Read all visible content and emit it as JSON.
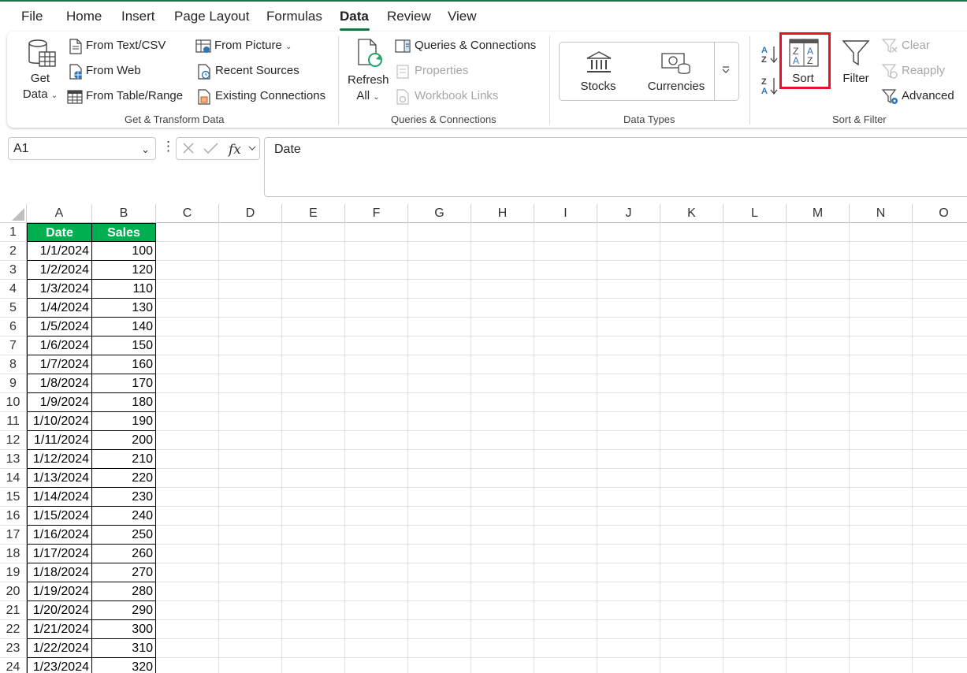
{
  "menu_tabs": [
    "File",
    "Home",
    "Insert",
    "Page Layout",
    "Formulas",
    "Data",
    "Review",
    "View"
  ],
  "active_tab": "Data",
  "ribbon": {
    "get_transform": {
      "get_data_line1": "Get",
      "get_data_line2": "Data",
      "from_text_csv": "From Text/CSV",
      "from_web": "From Web",
      "from_table_range": "From Table/Range",
      "from_picture": "From Picture",
      "recent_sources": "Recent Sources",
      "existing_connections": "Existing Connections",
      "label": "Get & Transform Data"
    },
    "queries": {
      "refresh_line1": "Refresh",
      "refresh_line2": "All",
      "queries_connections": "Queries & Connections",
      "properties": "Properties",
      "workbook_links": "Workbook Links",
      "label": "Queries & Connections"
    },
    "data_types": {
      "stocks": "Stocks",
      "currencies": "Currencies",
      "label": "Data Types"
    },
    "sort_filter": {
      "sort": "Sort",
      "filter": "Filter",
      "clear": "Clear",
      "reapply": "Reapply",
      "advanced": "Advanced",
      "label": "Sort & Filter"
    }
  },
  "formula_bar": {
    "name_box": "A1",
    "formula": "Date"
  },
  "sheet": {
    "columns": [
      "A",
      "B",
      "C",
      "D",
      "E",
      "F",
      "G",
      "H",
      "I",
      "J",
      "K",
      "L",
      "M",
      "N",
      "O"
    ],
    "header": [
      "Date",
      "Sales"
    ],
    "rows": [
      [
        "1/1/2024",
        "100"
      ],
      [
        "1/2/2024",
        "120"
      ],
      [
        "1/3/2024",
        "110"
      ],
      [
        "1/4/2024",
        "130"
      ],
      [
        "1/5/2024",
        "140"
      ],
      [
        "1/6/2024",
        "150"
      ],
      [
        "1/7/2024",
        "160"
      ],
      [
        "1/8/2024",
        "170"
      ],
      [
        "1/9/2024",
        "180"
      ],
      [
        "1/10/2024",
        "190"
      ],
      [
        "1/11/2024",
        "200"
      ],
      [
        "1/12/2024",
        "210"
      ],
      [
        "1/13/2024",
        "220"
      ],
      [
        "1/14/2024",
        "230"
      ],
      [
        "1/15/2024",
        "240"
      ],
      [
        "1/16/2024",
        "250"
      ],
      [
        "1/17/2024",
        "260"
      ],
      [
        "1/18/2024",
        "270"
      ],
      [
        "1/19/2024",
        "280"
      ],
      [
        "1/20/2024",
        "290"
      ],
      [
        "1/21/2024",
        "300"
      ],
      [
        "1/22/2024",
        "310"
      ],
      [
        "1/23/2024",
        "320"
      ]
    ]
  },
  "colors": {
    "header_fill": "#00b050",
    "accent": "#1e7145",
    "highlight": "#e81123"
  }
}
